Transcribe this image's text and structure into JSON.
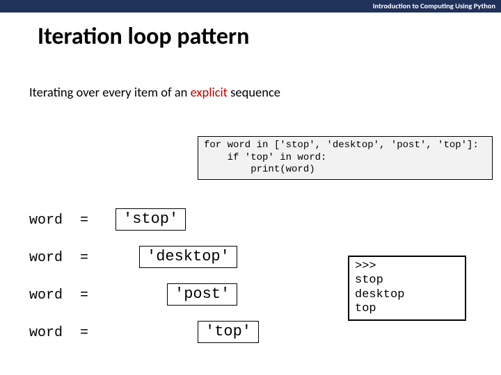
{
  "topbar": "Introduction to Computing Using Python",
  "title": "Iteration loop pattern",
  "subtitle_prefix": "Iterating over every item of an ",
  "subtitle_emph": "explicit",
  "subtitle_suffix": " sequence",
  "code": "for word in ['stop', 'desktop', 'post', 'top']:\n    if 'top' in word:\n        print(word)",
  "assignments": [
    {
      "var": "word",
      "eq": "=",
      "value": "'stop'"
    },
    {
      "var": "word",
      "eq": "=",
      "value": "'desktop'"
    },
    {
      "var": "word",
      "eq": "=",
      "value": "'post'"
    },
    {
      "var": "word",
      "eq": "=",
      "value": "'top'"
    }
  ],
  "output": ">>>\nstop\ndesktop\ntop"
}
